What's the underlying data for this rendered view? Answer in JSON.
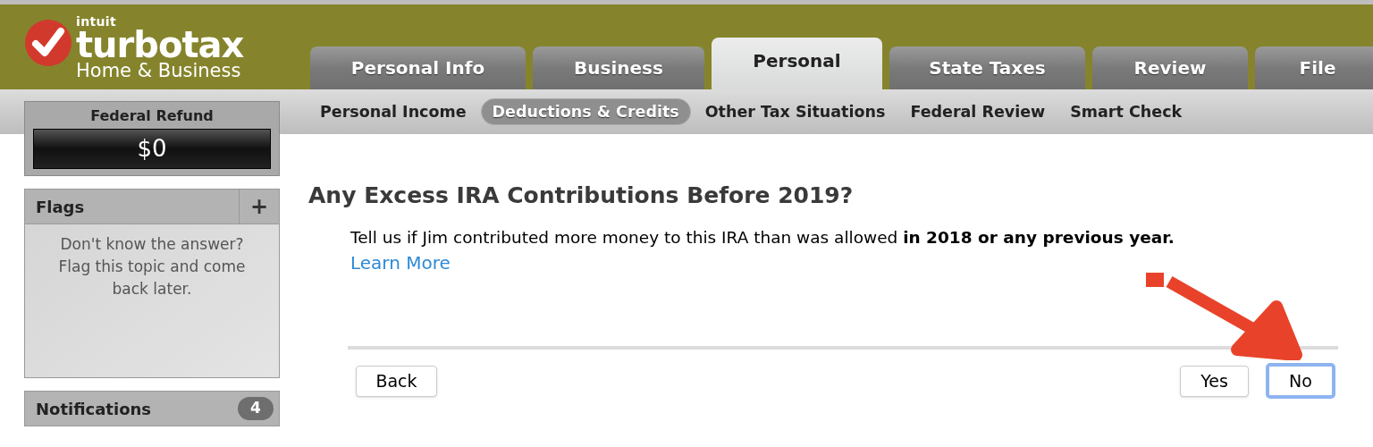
{
  "logo": {
    "company": "intuit",
    "product": "turbotax",
    "edition": "Home & Business"
  },
  "tabs": [
    {
      "label": "Personal Info",
      "selected": false
    },
    {
      "label": "Business",
      "selected": false
    },
    {
      "label": "Personal",
      "selected": true
    },
    {
      "label": "State Taxes",
      "selected": false
    },
    {
      "label": "Review",
      "selected": false
    },
    {
      "label": "File",
      "selected": false
    }
  ],
  "subtabs": [
    {
      "label": "Personal Income",
      "selected": false
    },
    {
      "label": "Deductions & Credits",
      "selected": true
    },
    {
      "label": "Other Tax Situations",
      "selected": false
    },
    {
      "label": "Federal Review",
      "selected": false
    },
    {
      "label": "Smart Check",
      "selected": false
    }
  ],
  "refund": {
    "label": "Federal Refund",
    "amount": "$0"
  },
  "flags": {
    "title": "Flags",
    "add": "+",
    "text": "Don't know the answer? Flag this topic and come back later."
  },
  "notifications": {
    "title": "Notifications",
    "count": "4"
  },
  "question": {
    "title": "Any Excess IRA Contributions Before 2019?",
    "text": "Tell us if Jim contributed more money to this IRA than was allowed **in 2018 or any previous year.**",
    "link": "Learn More"
  },
  "buttons": {
    "back": "Back",
    "yes": "Yes",
    "no": {
      "label": "No",
      "focused": true
    }
  }
}
